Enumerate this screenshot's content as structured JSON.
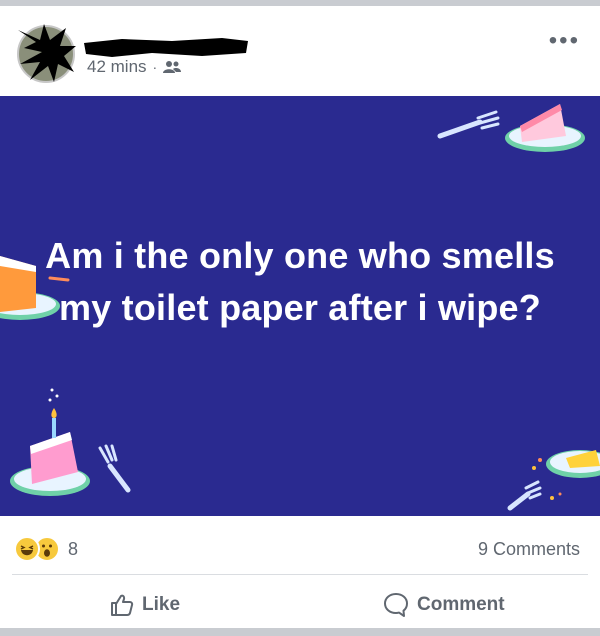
{
  "post": {
    "author_name": "",
    "timestamp": "42 mins",
    "audience_icon": "friends-icon",
    "menu_label": "•••",
    "text": "Am i the only one who smells my toilet paper after i wipe?",
    "banner_color": "#2a2a90"
  },
  "reactions": {
    "icons": [
      "haha-reaction-icon",
      "wow-reaction-icon"
    ],
    "count": "8"
  },
  "comments_count": "9 Comments",
  "actions": {
    "like_label": "Like",
    "comment_label": "Comment"
  }
}
